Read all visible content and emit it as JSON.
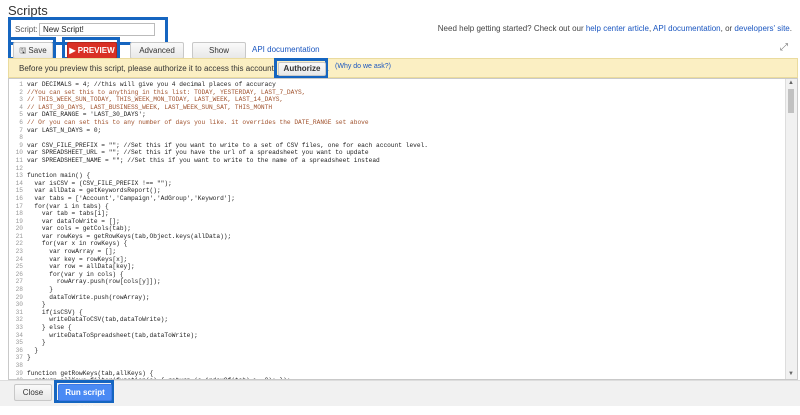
{
  "page": {
    "title": "Scripts"
  },
  "script_name": {
    "label": "Script:",
    "value": "New Script!"
  },
  "help": {
    "prefix": "Need help getting started? Check out our ",
    "link1": "help center article",
    "sep1": ", ",
    "link2": "API documentation",
    "sep2": ", or ",
    "link3": "developers' site",
    "suffix": "."
  },
  "toolbar": {
    "save_label": "Save",
    "preview_label": "PREVIEW",
    "advanced_apis_label": "Advanced APIs",
    "examples_label": "Show examples",
    "api_doc_link": "API documentation",
    "expand_icon": "expand-icon"
  },
  "auth_banner": {
    "text": "Before you preview this script, please authorize it to access this account on your behalf.",
    "authorize_label": "Authorize now",
    "why_link": "(Why do we ask?)"
  },
  "code": [
    {
      "n": "1",
      "text": "var DECIMALS = 4; //this will give you 4 decimal places of accuracy",
      "kind": "code"
    },
    {
      "n": "2",
      "text": "//You can set this to anything in this list: TODAY, YESTERDAY, LAST_7_DAYS,",
      "kind": "comment"
    },
    {
      "n": "3",
      "text": "// THIS_WEEK_SUN_TODAY, THIS_WEEK_MON_TODAY, LAST_WEEK, LAST_14_DAYS,",
      "kind": "comment"
    },
    {
      "n": "4",
      "text": "// LAST_30_DAYS, LAST_BUSINESS_WEEK, LAST_WEEK_SUN_SAT, THIS_MONTH",
      "kind": "comment"
    },
    {
      "n": "5",
      "text": "var DATE_RANGE = 'LAST_30_DAYS';",
      "kind": "code"
    },
    {
      "n": "6",
      "text": "// Or you can set this to any number of days you like. it overrides the DATE_RANGE set above",
      "kind": "comment"
    },
    {
      "n": "7",
      "text": "var LAST_N_DAYS = 0;",
      "kind": "code"
    },
    {
      "n": "8",
      "text": "",
      "kind": "code"
    },
    {
      "n": "9",
      "text": "var CSV_FILE_PREFIX = \"\"; //Set this if you want to write to a set of CSV files, one for each account level.",
      "kind": "code"
    },
    {
      "n": "10",
      "text": "var SPREADSHEET_URL = \"\"; //Set this if you have the url of a spreadsheet you want to update",
      "kind": "code"
    },
    {
      "n": "11",
      "text": "var SPREADSHEET_NAME = \"\"; //Set this if you want to write to the name of a spreadsheet instead",
      "kind": "code"
    },
    {
      "n": "12",
      "text": "",
      "kind": "code"
    },
    {
      "n": "13",
      "text": "function main() {",
      "kind": "code"
    },
    {
      "n": "14",
      "text": "  var isCSV = (CSV_FILE_PREFIX !== \"\");",
      "kind": "code"
    },
    {
      "n": "15",
      "text": "  var allData = getKeywordsReport();",
      "kind": "code"
    },
    {
      "n": "16",
      "text": "  var tabs = ['Account','Campaign','AdGroup','Keyword'];",
      "kind": "code"
    },
    {
      "n": "17",
      "text": "  for(var i in tabs) {",
      "kind": "code"
    },
    {
      "n": "18",
      "text": "    var tab = tabs[i];",
      "kind": "code"
    },
    {
      "n": "19",
      "text": "    var dataToWrite = [];",
      "kind": "code"
    },
    {
      "n": "20",
      "text": "    var cols = getCols(tab);",
      "kind": "code"
    },
    {
      "n": "21",
      "text": "    var rowKeys = getRowKeys(tab,Object.keys(allData));",
      "kind": "code"
    },
    {
      "n": "22",
      "text": "    for(var x in rowKeys) {",
      "kind": "code"
    },
    {
      "n": "23",
      "text": "      var rowArray = [];",
      "kind": "code"
    },
    {
      "n": "24",
      "text": "      var key = rowKeys[x];",
      "kind": "code"
    },
    {
      "n": "25",
      "text": "      var row = allData[key];",
      "kind": "code"
    },
    {
      "n": "26",
      "text": "      for(var y in cols) {",
      "kind": "code"
    },
    {
      "n": "27",
      "text": "        rowArray.push(row[cols[y]]);",
      "kind": "code"
    },
    {
      "n": "28",
      "text": "      }",
      "kind": "code"
    },
    {
      "n": "29",
      "text": "      dataToWrite.push(rowArray);",
      "kind": "code"
    },
    {
      "n": "30",
      "text": "    }",
      "kind": "code"
    },
    {
      "n": "31",
      "text": "    if(isCSV) {",
      "kind": "code"
    },
    {
      "n": "32",
      "text": "      writeDataToCSV(tab,dataToWrite);",
      "kind": "code"
    },
    {
      "n": "33",
      "text": "    } else {",
      "kind": "code"
    },
    {
      "n": "34",
      "text": "      writeDataToSpreadsheet(tab,dataToWrite);",
      "kind": "code"
    },
    {
      "n": "35",
      "text": "    }",
      "kind": "code"
    },
    {
      "n": "36",
      "text": "  }",
      "kind": "code"
    },
    {
      "n": "37",
      "text": "}",
      "kind": "code"
    },
    {
      "n": "38",
      "text": "",
      "kind": "code"
    },
    {
      "n": "39",
      "text": "function getRowKeys(tab,allKeys) {",
      "kind": "code"
    },
    {
      "n": "40",
      "text": "  return allKeys.filter(function(e) { return (e.indexOf(tab) >= 0); });",
      "kind": "code"
    },
    {
      "n": "41",
      "text": "}",
      "kind": "code"
    }
  ],
  "footer": {
    "close_label": "Close",
    "run_label": "Run script now"
  }
}
